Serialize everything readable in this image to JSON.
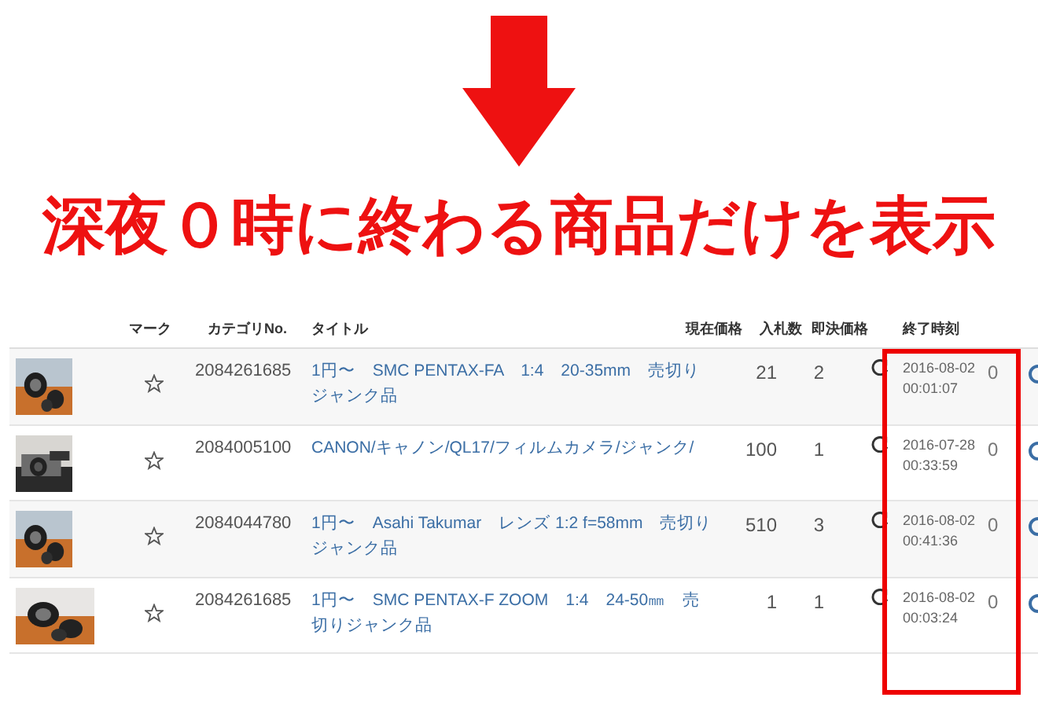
{
  "headline": "深夜０時に終わる商品だけを表示",
  "table": {
    "columns": [
      "マーク",
      "カテゴリNo.",
      "タイトル",
      "現在価格",
      "入札数",
      "即決価格",
      "終了時刻"
    ],
    "rows": [
      {
        "marked": false,
        "category": "2084261685",
        "title": "1円〜　SMC PENTAX-FA　1:4　20-35mm　売切りジャンク品",
        "price": "21",
        "bids": "2",
        "end_time": "2016-08-02 00:01:07",
        "count": "0"
      },
      {
        "marked": false,
        "category": "2084005100",
        "title": "CANON/キャノン/QL17/フィルムカメラ/ジャンク/",
        "price": "100",
        "bids": "1",
        "end_time": "2016-07-28 00:33:59",
        "count": "0"
      },
      {
        "marked": false,
        "category": "2084044780",
        "title": "1円〜　Asahi Takumar　レンズ 1:2 f=58mm　売切りジャンク品",
        "price": "510",
        "bids": "3",
        "end_time": "2016-08-02 00:41:36",
        "count": "0"
      },
      {
        "marked": false,
        "category": "2084261685",
        "title": "1円〜　SMC PENTAX-F ZOOM　1:4　24-50㎜　売切りジャンク品",
        "price": "1",
        "bids": "1",
        "end_time": "2016-08-02 00:03:24",
        "count": "0"
      }
    ]
  }
}
